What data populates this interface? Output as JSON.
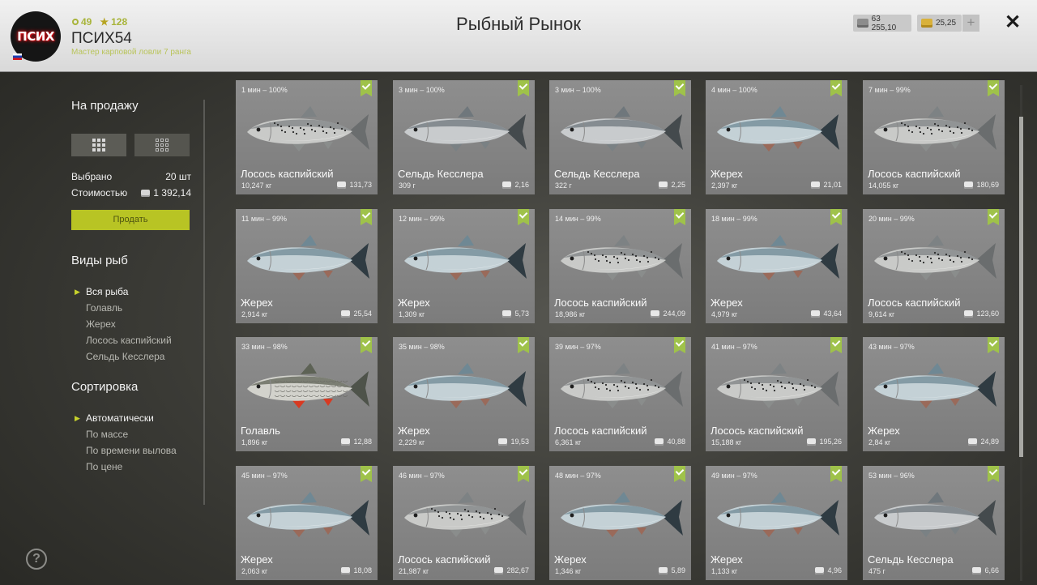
{
  "header": {
    "avatar_text": "ПСИХ",
    "level": "49",
    "stars": "128",
    "username": "ПСИХ54",
    "rank": "Мастер карповой ловли 7 ранга",
    "title": "Рыбный Рынок",
    "silver": "63 255,10",
    "gold": "25,25",
    "plus": "+",
    "close": "✕"
  },
  "sidebar": {
    "for_sale_title": "На продажу",
    "selected_label": "Выбрано",
    "selected_value": "20 шт",
    "cost_label": "Стоимостью",
    "cost_value": "1 392,14",
    "sell_button": "Продать",
    "species_title": "Виды рыб",
    "species": [
      "Вся рыба",
      "Голавль",
      "Жерех",
      "Лосось каспийский",
      "Сельдь Кесслера"
    ],
    "sort_title": "Сортировка",
    "sort": [
      "Автоматически",
      "По массе",
      "По времени вылова",
      "По цене"
    ],
    "help": "?"
  },
  "colors": {
    "accent": "#b8c424",
    "check": "#9fc24a",
    "header_bg": "#e6e6e6"
  },
  "fish": [
    {
      "time": "1 мин – 100%",
      "name": "Лосось каспийский",
      "weight": "10,247 кг",
      "price": "131,73",
      "kind": "salmon"
    },
    {
      "time": "3 мин – 100%",
      "name": "Сельдь Кесслера",
      "weight": "309 г",
      "price": "2,16",
      "kind": "herring"
    },
    {
      "time": "3 мин – 100%",
      "name": "Сельдь Кесслера",
      "weight": "322 г",
      "price": "2,25",
      "kind": "herring"
    },
    {
      "time": "4 мин – 100%",
      "name": "Жерех",
      "weight": "2,397 кг",
      "price": "21,01",
      "kind": "asp"
    },
    {
      "time": "7 мин – 99%",
      "name": "Лосось каспийский",
      "weight": "14,055 кг",
      "price": "180,69",
      "kind": "salmon"
    },
    {
      "time": "11 мин – 99%",
      "name": "Жерех",
      "weight": "2,914 кг",
      "price": "25,54",
      "kind": "asp"
    },
    {
      "time": "12 мин – 99%",
      "name": "Жерех",
      "weight": "1,309 кг",
      "price": "5,73",
      "kind": "asp"
    },
    {
      "time": "14 мин – 99%",
      "name": "Лосось каспийский",
      "weight": "18,986 кг",
      "price": "244,09",
      "kind": "salmon"
    },
    {
      "time": "18 мин – 99%",
      "name": "Жерех",
      "weight": "4,979 кг",
      "price": "43,64",
      "kind": "asp"
    },
    {
      "time": "20 мин – 99%",
      "name": "Лосось каспийский",
      "weight": "9,614 кг",
      "price": "123,60",
      "kind": "salmon"
    },
    {
      "time": "33 мин – 98%",
      "name": "Голавль",
      "weight": "1,896 кг",
      "price": "12,88",
      "kind": "chub"
    },
    {
      "time": "35 мин – 98%",
      "name": "Жерех",
      "weight": "2,229 кг",
      "price": "19,53",
      "kind": "asp"
    },
    {
      "time": "39 мин – 97%",
      "name": "Лосось каспийский",
      "weight": "6,361 кг",
      "price": "40,88",
      "kind": "salmon"
    },
    {
      "time": "41 мин – 97%",
      "name": "Лосось каспийский",
      "weight": "15,188 кг",
      "price": "195,26",
      "kind": "salmon"
    },
    {
      "time": "43 мин – 97%",
      "name": "Жерех",
      "weight": "2,84 кг",
      "price": "24,89",
      "kind": "asp"
    },
    {
      "time": "45 мин – 97%",
      "name": "Жерех",
      "weight": "2,063 кг",
      "price": "18,08",
      "kind": "asp"
    },
    {
      "time": "46 мин – 97%",
      "name": "Лосось каспийский",
      "weight": "21,987 кг",
      "price": "282,67",
      "kind": "salmon"
    },
    {
      "time": "48 мин – 97%",
      "name": "Жерех",
      "weight": "1,346 кг",
      "price": "5,89",
      "kind": "asp"
    },
    {
      "time": "49 мин – 97%",
      "name": "Жерех",
      "weight": "1,133 кг",
      "price": "4,96",
      "kind": "asp"
    },
    {
      "time": "53 мин – 96%",
      "name": "Сельдь Кесслера",
      "weight": "475 г",
      "price": "6,66",
      "kind": "herring"
    }
  ]
}
